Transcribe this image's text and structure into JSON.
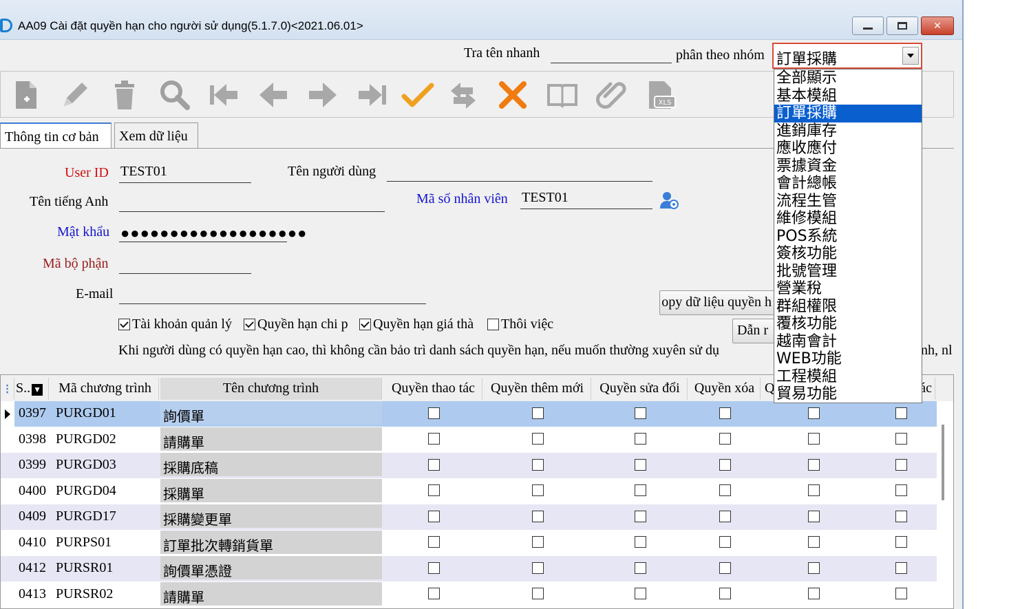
{
  "window": {
    "title": "AA09 Cài đặt quyền hạn cho người sử dụng(5.1.7.0)<2021.06.01>"
  },
  "search": {
    "quick_label": "Tra tên nhanh",
    "quick_value": "",
    "group_label": "phân theo nhóm",
    "group_selected": "訂單採購",
    "group_options": [
      "全部顯示",
      "基本模組",
      "訂單採購",
      "進銷庫存",
      "應收應付",
      "票據資金",
      "會計總帳",
      "流程生管",
      "維修模組",
      "POS系統",
      "簽核功能",
      "批號管理",
      "營業稅",
      "群組權限",
      "覆核功能",
      "越南會計",
      "WEB功能",
      "工程模組",
      "貿易功能"
    ]
  },
  "toolbar": {
    "icons": [
      "new-icon",
      "edit-icon",
      "delete-icon",
      "search-icon",
      "first-icon",
      "prev-icon",
      "next-icon",
      "last-icon",
      "confirm-icon",
      "refresh-icon",
      "cancel-icon",
      "book-icon",
      "attach-icon",
      "export-xls-icon"
    ],
    "colors": {
      "confirm": "#f0a020",
      "cancel": "#f07b10",
      "default": "#a0a0a0"
    }
  },
  "tabs": {
    "basic": "Thông tin cơ bản",
    "data": "Xem dữ liệu"
  },
  "form": {
    "user_id_label": "User ID",
    "user_id": "TEST01",
    "user_name_label": "Tên người dùng",
    "user_name": "",
    "english_name_label": "Tên tiếng Anh",
    "english_name": "",
    "employee_no_label": "Mã số nhân viên",
    "employee_no": "TEST01",
    "password_label": "Mật khẩu",
    "password": "●●●●●●●●●●●●●●●●●●●",
    "dept_label": "Mã bộ phận",
    "dept": "",
    "email_label": "E-mail",
    "email": "",
    "copy_button": "opy dữ liệu quyền h",
    "import_button": "Dẫn r",
    "checks": {
      "admin": {
        "label": "Tài khoản quản lý",
        "checked": true
      },
      "expense": {
        "label": "Quyền hạn chi p",
        "checked": true
      },
      "price": {
        "label": "Quyền hạn giá thà",
        "checked": true
      },
      "resigned": {
        "label": "Thôi việc",
        "checked": false
      }
    },
    "note": "Khi người dùng có quyền hạn cao, thì không cần bảo trì danh sách quyền hạn, nếu muốn thường xuyên sử dụ"
  },
  "grid": {
    "headers": {
      "no": "S..",
      "code": "Mã chương trình",
      "name": "Tên chương trình",
      "operate": "Quyền thao tác",
      "add": "Quyền thêm mới",
      "edit": "Quyền sửa đổi",
      "delete": "Quyền xóa",
      "col5": "Q",
      "col6": "ác",
      "note_tail": "nh, nl"
    },
    "rows": [
      {
        "no": "0397",
        "code": "PURGD01",
        "name": "詢價單"
      },
      {
        "no": "0398",
        "code": "PURGD02",
        "name": "請購單"
      },
      {
        "no": "0399",
        "code": "PURGD03",
        "name": "採購底稿"
      },
      {
        "no": "0400",
        "code": "PURGD04",
        "name": "採購單"
      },
      {
        "no": "0409",
        "code": "PURGD17",
        "name": "採購變更單"
      },
      {
        "no": "0410",
        "code": "PURPS01",
        "name": "訂單批次轉銷貨單"
      },
      {
        "no": "0412",
        "code": "PURSR01",
        "name": "詢價單憑證"
      },
      {
        "no": "0413",
        "code": "PURSR02",
        "name": "請購單"
      }
    ],
    "selected_row": 0,
    "row_colors": {
      "selected": "#aecbef",
      "odd": "#e6e6f4",
      "even": "#ffffff"
    }
  }
}
